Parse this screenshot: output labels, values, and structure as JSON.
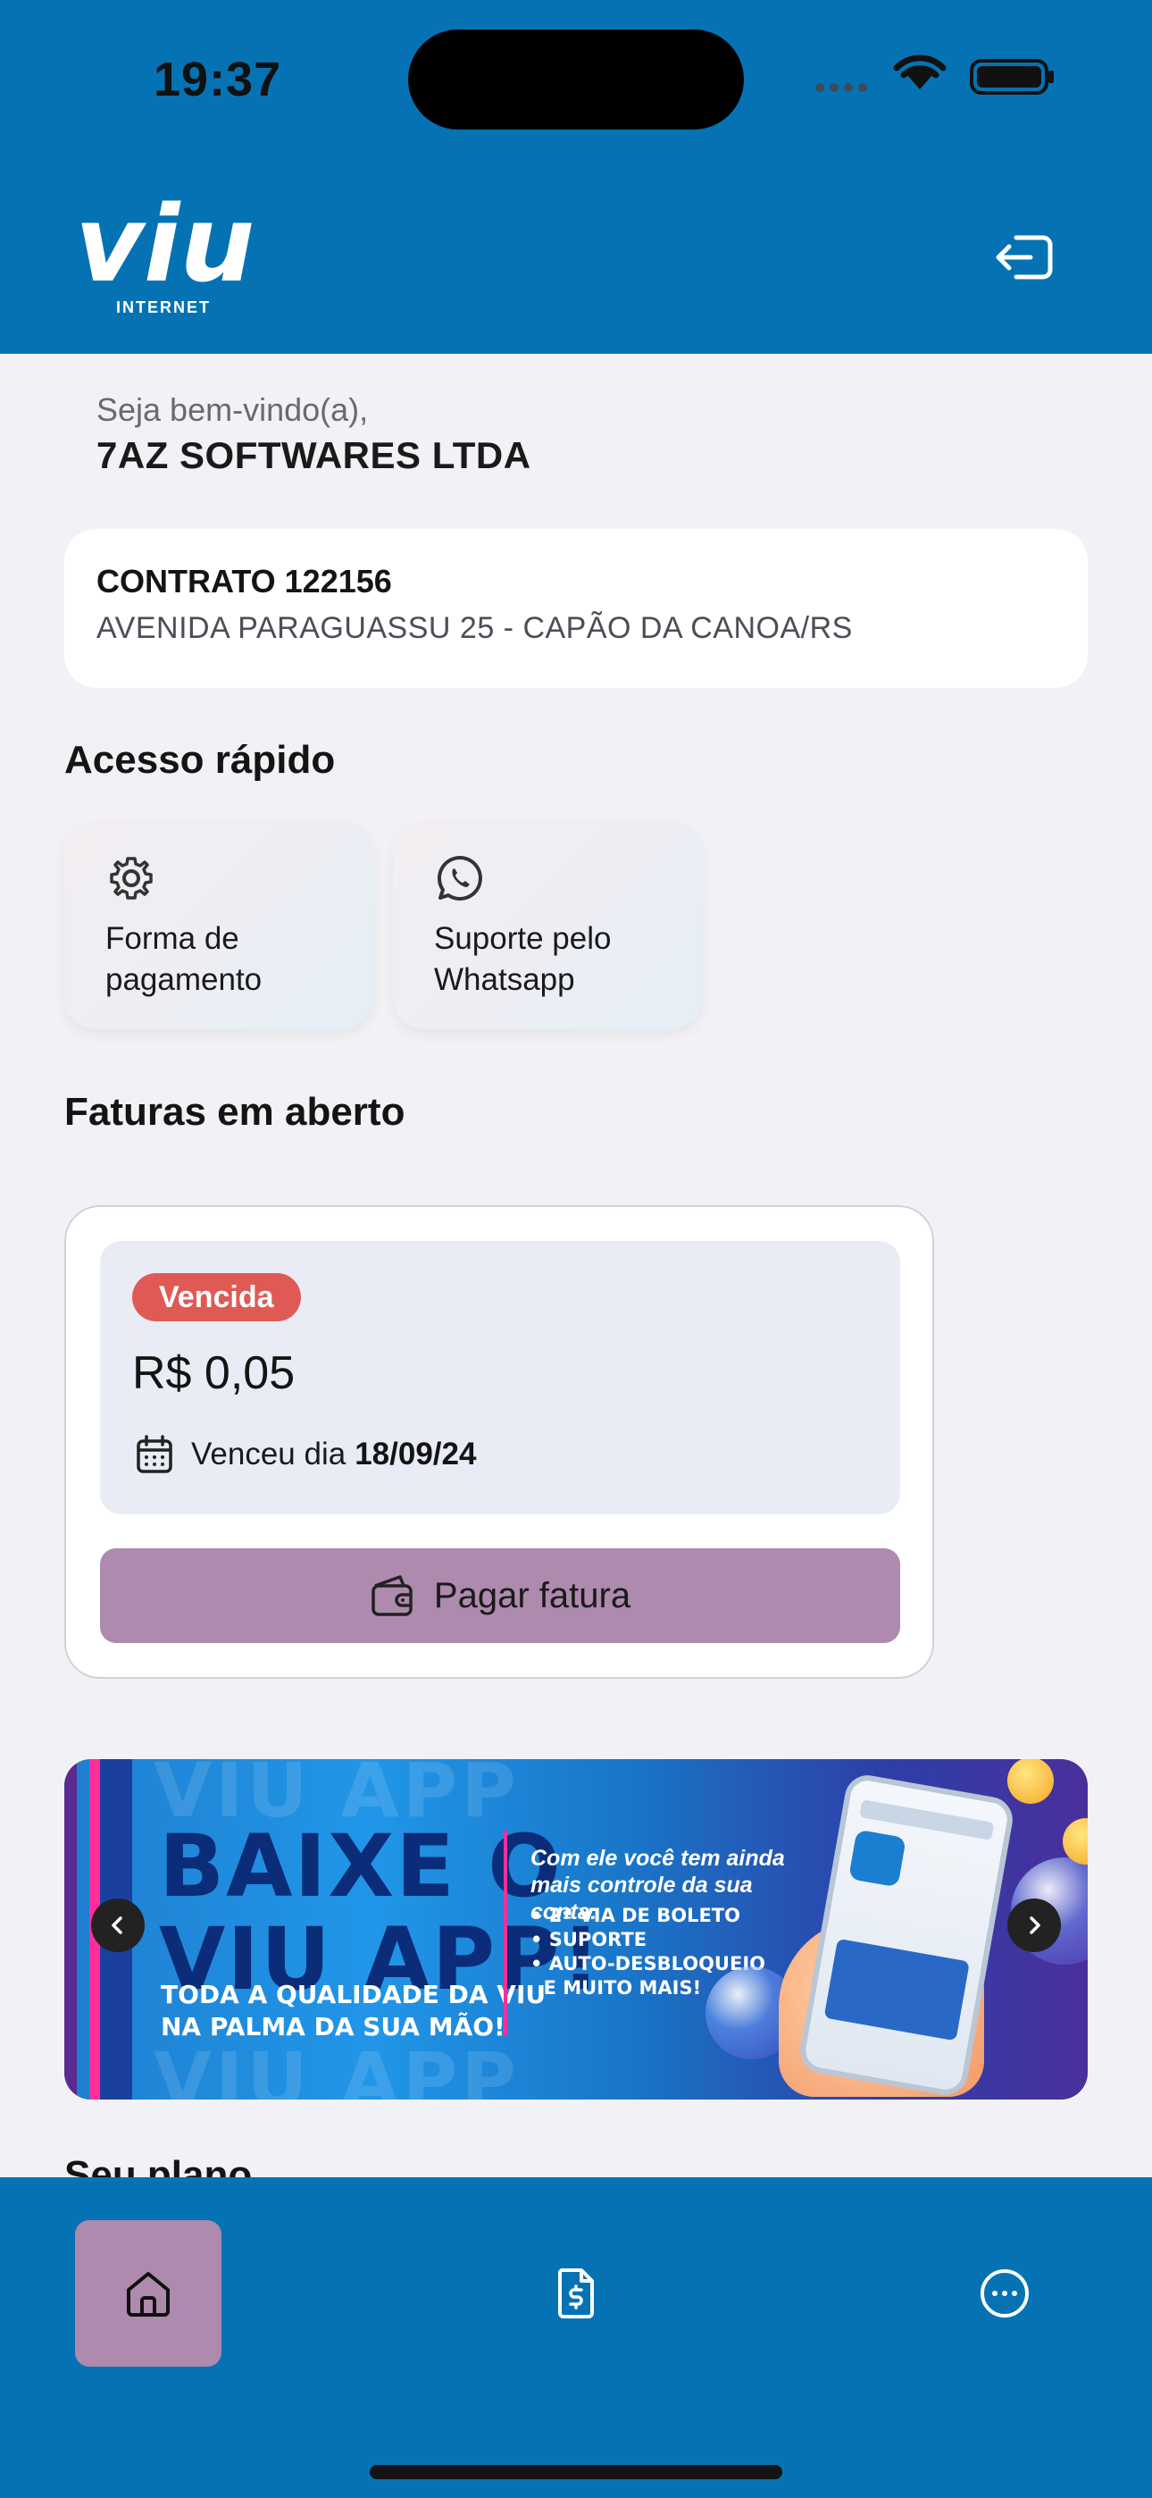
{
  "status_bar": {
    "time": "19:37"
  },
  "header": {
    "logo_text": "viu",
    "logo_subtext": "INTERNET"
  },
  "welcome": {
    "greeting": "Seja bem-vindo(a),",
    "company": "7AZ SOFTWARES LTDA"
  },
  "contract": {
    "title": "CONTRATO 122156",
    "address": "AVENIDA PARAGUASSU 25 - CAPÃO DA CANOA/RS"
  },
  "quick_access": {
    "title": "Acesso rápido",
    "items": [
      {
        "label": "Forma de pagamento",
        "icon": "gear-icon"
      },
      {
        "label": "Suporte pelo Whatsapp",
        "icon": "whatsapp-icon"
      }
    ]
  },
  "invoices": {
    "title": "Faturas em aberto",
    "items": [
      {
        "status": "Vencida",
        "amount": "R$ 0,05",
        "due_label": "Venceu dia",
        "due_date": "18/09/24",
        "pay_label": "Pagar fatura"
      }
    ]
  },
  "banner": {
    "headline_line1": "BAIXE O",
    "headline_line2": "VIU APP!",
    "sub_line1": "TODA A QUALIDADE DA VIU",
    "sub_line2": "NA PALMA DA SUA MÃO!",
    "intro": "Com ele você tem ainda mais controle da sua conta:",
    "features": [
      "• 2ª VIA DE BOLETO",
      "• SUPORTE",
      "• AUTO-DESBLOQUEIO",
      "  E MUITO MAIS!"
    ],
    "ghost_text": "VIU APP"
  },
  "plan_section": {
    "title": "Seu plano"
  },
  "tab_bar": {
    "tabs": [
      {
        "name": "home",
        "icon": "home-icon",
        "active": true
      },
      {
        "name": "invoices",
        "icon": "invoice-icon",
        "active": false
      },
      {
        "name": "more",
        "icon": "more-icon",
        "active": false
      }
    ]
  },
  "colors": {
    "brand_blue": "#0573b3",
    "accent_purple": "#ad8aae",
    "overdue_red": "#e05a55"
  }
}
